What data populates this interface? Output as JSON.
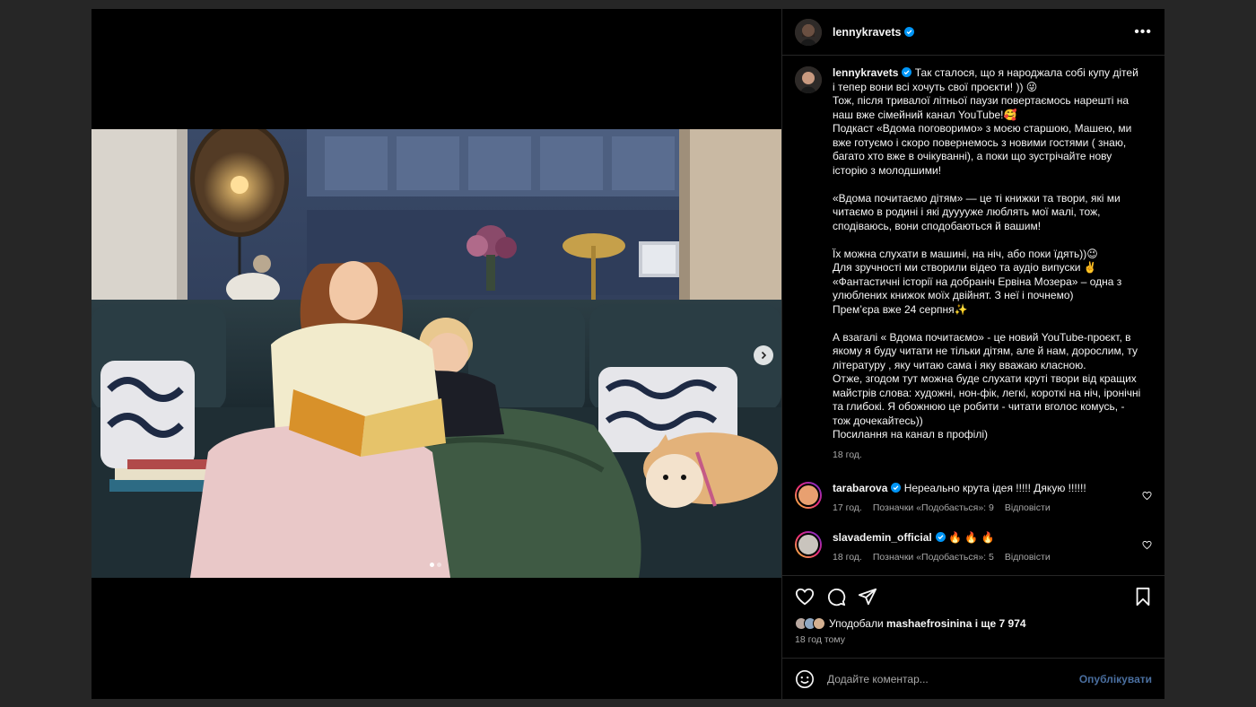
{
  "post": {
    "username": "lennykravets",
    "caption": "Так сталося, що я народжала собі купу дітей і тепер вони всі хочуть свої проєкти! )) 😜\nТож, після тривалої літньої паузи повертаємось нарешті на наш вже сімейний канал YouTube!🥰\nПодкаст «Вдома поговоримо» з моєю старшою, Машею, ми вже готуємо і скоро повернемось з новими гостями ( знаю, багато хто вже в очікуванні), а поки що зустрічайте нову історію з молодшими!\n\n«Вдома почитаємо дітям» — це ті книжки та твори, які ми читаємо в родині і які дууууже люблять мої малі, тож, сподіваюсь, вони сподобаються й вашим!\n\nЇх можна слухати в машині, на ніч, або поки їдять))😉\nДля зручності ми створили відео та аудіо випуски ✌️\n«Фантастичні історії на добраніч Ервіна Мозера» – одна з улюблених книжок моїх двійнят. З неї і почнемо)\nПрем’єра вже 24 серпня✨\n\nА взагалі « Вдома почитаємо» - це новий YouTube-проєкт, в якому я буду читати не тільки дітям, але й нам, дорослим, ту літературу , яку читаю сама і яку вважаю класною.\nОтже, згодом тут можна буде слухати круті твори від кращих майстрів слова: художні, нон-фік, легкі, короткі на ніч, іронічні та глибокі. Я обожнюю це робити - читати вголос комусь, - тож дочекайтесь))\nПосилання на канал в профілі)",
    "caption_time": "18 год."
  },
  "comments": [
    {
      "username": "tarabarova",
      "text": "Нереально крута ідея !!!!! Дякую !!!!!!",
      "time": "17 год.",
      "likes": "Позначки «Подобається»: 9",
      "reply": "Відповісти",
      "avatar_color": "#e8a070"
    },
    {
      "username": "slavademin_official",
      "text": "🔥 🔥 🔥",
      "time": "18 год.",
      "likes": "Позначки «Подобається»: 5",
      "reply": "Відповісти",
      "avatar_color": "#c9c4bd"
    }
  ],
  "actions": {
    "liked_by_prefix": "Уподобали",
    "liked_by_user": "mashaefrosinina",
    "liked_by_suffix": "і ще 7 974",
    "time_ago": "18 год тому"
  },
  "comment_box": {
    "placeholder": "Додайте коментар...",
    "post_label": "Опублікувати"
  },
  "carousel": {
    "total": 2,
    "current": 1
  },
  "colors": {
    "verified": "#0095f6",
    "background": "#000000",
    "overlay": "#262626"
  }
}
